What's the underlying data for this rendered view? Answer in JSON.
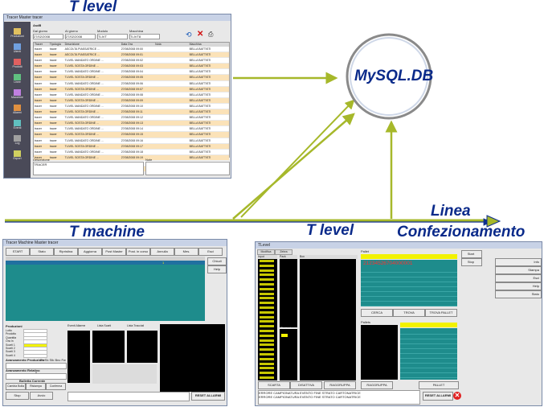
{
  "labels": {
    "t_level_top": "T level",
    "db": "MySQL.DB",
    "t_machine": "T machine",
    "t_level_bottom": "T level",
    "linea": "Linea",
    "confezionamento": "Confezionamento"
  },
  "top_window": {
    "title": "Tracer Master tracer",
    "app_name": "AsdB",
    "sidebar": [
      "Produzioni",
      "Utenti",
      "Prodotti",
      "Linee",
      "Macchine",
      "Allarmi",
      "Eventi",
      "Log",
      "Export"
    ],
    "filter_labels": [
      "Dal giorno",
      "Al giorno",
      "Modulo",
      "Macchina"
    ],
    "filter_values": [
      "27/02/2008",
      "27/02/2008",
      "TLIVT",
      "TLIVT8"
    ],
    "columns": [
      "Tracer",
      "Tipologia",
      "Descrizione",
      "Data Ora",
      "Nota",
      "Macchina"
    ],
    "rows": [
      [
        "tracer",
        "tracer",
        "ASCOLTA PIASSATRICE ...",
        "27/08/2008 09:00",
        "",
        "BELLA BATTISTI"
      ],
      [
        "tracer",
        "tracer",
        "ASCOLTA PIASSATRICE ...",
        "27/08/2008 09:01",
        "",
        "BELLA BATTISTI"
      ],
      [
        "tracer",
        "tracer",
        "TLIVEL MANDATO ORDINE ...",
        "27/08/2008 09:02",
        "",
        "BELLA BATTISTI"
      ],
      [
        "tracer",
        "tracer",
        "TLIVEL SOSTA ORDINE ...",
        "27/08/2008 09:03",
        "",
        "BELLA BATTISTI"
      ],
      [
        "tracer",
        "tracer",
        "TLIVEL MANDATO ORDINE ...",
        "27/08/2008 09:04",
        "",
        "BELLA BATTISTI"
      ],
      [
        "tracer",
        "tracer",
        "TLIVEL SOSTA ORDINE ...",
        "27/08/2008 09:05",
        "",
        "BELLA BATTISTI"
      ],
      [
        "tracer",
        "tracer",
        "TLIVEL MANDATO ORDINE ...",
        "27/08/2008 09:06",
        "",
        "BELLA BATTISTI"
      ],
      [
        "tracer",
        "tracer",
        "TLIVEL SOSTA ORDINE ...",
        "27/08/2008 09:07",
        "",
        "BELLA BATTISTI"
      ],
      [
        "tracer",
        "tracer",
        "TLIVEL MANDATO ORDINE ...",
        "27/08/2008 09:08",
        "",
        "BELLA BATTISTI"
      ],
      [
        "tracer",
        "tracer",
        "TLIVEL SOSTA ORDINE ...",
        "27/08/2008 09:09",
        "",
        "BELLA BATTISTI"
      ],
      [
        "tracer",
        "tracer",
        "TLIVEL MANDATO ORDINE ...",
        "27/08/2008 09:10",
        "",
        "BELLA BATTISTI"
      ],
      [
        "tracer",
        "tracer",
        "TLIVEL SOSTA ORDINE ...",
        "27/08/2008 09:11",
        "",
        "BELLA BATTISTI"
      ],
      [
        "tracer",
        "tracer",
        "TLIVEL MANDATO ORDINE ...",
        "27/08/2008 09:12",
        "",
        "BELLA BATTISTI"
      ],
      [
        "tracer",
        "tracer",
        "TLIVEL SOSTA ORDINE ...",
        "27/08/2008 09:13",
        "",
        "BELLA BATTISTI"
      ],
      [
        "tracer",
        "tracer",
        "TLIVEL MANDATO ORDINE ...",
        "27/08/2008 09:14",
        "",
        "BELLA BATTISTI"
      ],
      [
        "tracer",
        "tracer",
        "TLIVEL SOSTA ORDINE ...",
        "27/08/2008 09:15",
        "",
        "BELLA BATTISTI"
      ],
      [
        "tracer",
        "tracer",
        "TLIVEL MANDATO ORDINE ...",
        "27/08/2008 09:16",
        "",
        "BELLA BATTISTI"
      ],
      [
        "tracer",
        "tracer",
        "TLIVEL SOSTA ORDINE ...",
        "27/08/2008 09:17",
        "",
        "BELLA BATTISTI"
      ],
      [
        "tracer",
        "tracer",
        "TLIVEL MANDATO ORDINE ...",
        "27/08/2008 09:18",
        "",
        "BELLA BATTISTI"
      ],
      [
        "tracer",
        "tracer",
        "TLIVEL SOSTA ORDINE ...",
        "27/08/2008 09:19",
        "",
        "BELLA BATTISTI"
      ],
      [
        "tracer",
        "tracer",
        "TLIVEL MANDATO ORDINE ...",
        "27/08/2008 09:20",
        "",
        "BELLA BATTISTI"
      ],
      [
        "tracer",
        "tracer",
        "TLIVEL SOSTA ORDINE ...",
        "27/08/2008 09:21",
        "",
        "BELLA BATTISTI"
      ]
    ],
    "desc_label": "Descrizione",
    "note_label": "Note",
    "desc_text": "TRACER"
  },
  "bl_window": {
    "title": "Tracer Machine Master tracer",
    "toolbar": [
      "START",
      "Stato",
      "Ripristina",
      "Aggiorna",
      "Post Master",
      "Post. in corso",
      "Annulla",
      "Mes.",
      "Esci"
    ],
    "side": [
      "Chiudi",
      "Help"
    ],
    "row_value": "1",
    "production_label": "Produzioni",
    "fields": [
      "Lotto",
      "Prodotto",
      "Quantita",
      "Ora In",
      "Scarti 1",
      "Scarti 2",
      "Scarti 3",
      "Scarti 4"
    ],
    "avanzamento_label": "Avanzamento Produzione",
    "avanzamento_hdr": "Pz  Sk  Stk  Bnc  Fw",
    "avanzamento_val": "0",
    "avanzamento_rel": "Avanzamento Relativo",
    "bolletta_label": "Bolletta Corrente",
    "bolletta_btns": [
      "Cambia Bolla",
      "Ristampa",
      "Conferma"
    ],
    "panel_labels": [
      "Eventi Allarme",
      "Lista Scarti",
      "Lista Tracciati"
    ],
    "bottom_btns": [
      "Stop",
      "Avvio"
    ],
    "reset": "RESET ALLARMI"
  },
  "br_window": {
    "title": "TLevel",
    "tabs": [
      "Modifica",
      "Zebra"
    ],
    "side": [
      "Start",
      "Stop",
      "Info",
      "Stampa",
      "Esci",
      "Help",
      "Stato"
    ],
    "code": "21234526704000001",
    "col_labels": [
      "Input",
      "Pack",
      "Box",
      "Pallet"
    ],
    "sub_labels": [
      "Cartoni",
      "Pallets"
    ],
    "btns": [
      "CERCA",
      "TROVA",
      "TROVA PALLET",
      "SCARTA",
      "DISATTIVA",
      "RAGGRUPPA",
      "RAGGRUPPA",
      "PALLET"
    ],
    "messages": [
      "ERRORE CAMPIONATURA EVENTO FINE STRATO CARTONATRICE",
      "ERRORE CAMPIONATURA EVENTO FINE STRATO CARTONATRICE"
    ],
    "reset": "RESET ALLARMI"
  },
  "colors": {
    "arrow": "#a6b82a",
    "label": "#0a2a8a",
    "teal": "#1e8c8c",
    "yellow": "#f2f200"
  }
}
